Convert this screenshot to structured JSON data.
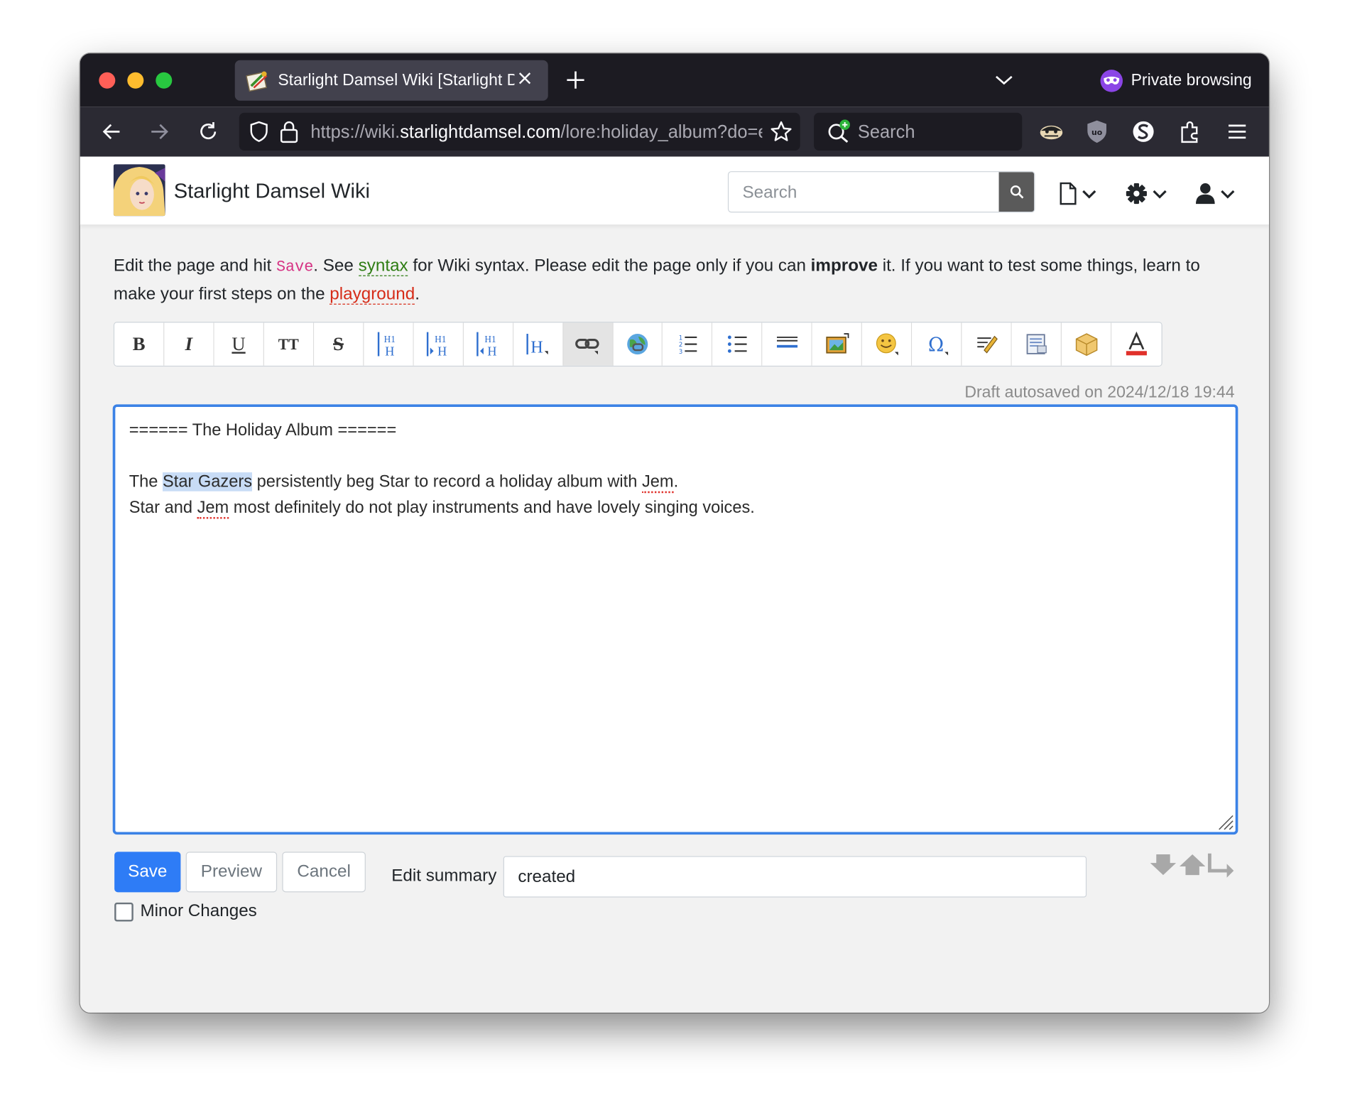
{
  "browser": {
    "tab_title": "Starlight Damsel Wiki [Starlight Damsel Wiki]",
    "tab_close": "✕",
    "private_label": "Private browsing",
    "url_prefix": "https://wiki.",
    "url_host": "starlightdamsel.com",
    "url_path": "/lore:holiday_album?do=edit",
    "search_placeholder": "Search"
  },
  "site": {
    "title": "Starlight Damsel Wiki",
    "search_placeholder": "Search"
  },
  "intro": {
    "t1": "Edit the page and hit ",
    "save": "Save",
    "t2": ". See ",
    "syntax": "syntax",
    "t3": " for Wiki syntax. Please edit the page only if you can ",
    "improve": "improve",
    "t4": " it. If you want to test some things, learn to make your first steps on the ",
    "playground": "playground",
    "t5": "."
  },
  "toolbar": {
    "bold": "B",
    "italic": "I",
    "underline": "U",
    "mono": "TT",
    "strike": "S",
    "h_same": "H",
    "h_lower": "H",
    "h_higher": "H",
    "h_select": "H"
  },
  "autosave": "Draft autosaved on 2024/12/18 19:44",
  "editor": {
    "line1": "====== The Holiday Album ======",
    "line3_a": "The ",
    "line3_sel": "Star Gazers",
    "line3_b": " persistently beg Star to record a holiday album with ",
    "line3_jem": "Jem",
    "line3_c": ".",
    "line4_a": "Star and ",
    "line4_jem": "Jem",
    "line4_b": " most definitely do not play instruments and have lovely singing voices."
  },
  "actions": {
    "save": "Save",
    "preview": "Preview",
    "cancel": "Cancel",
    "summary_label": "Edit summary",
    "summary_value": "created",
    "minor": "Minor Changes"
  },
  "colors": {
    "accent": "#2e7cf6",
    "focus": "#3b82e6",
    "private": "#8b45e6"
  }
}
